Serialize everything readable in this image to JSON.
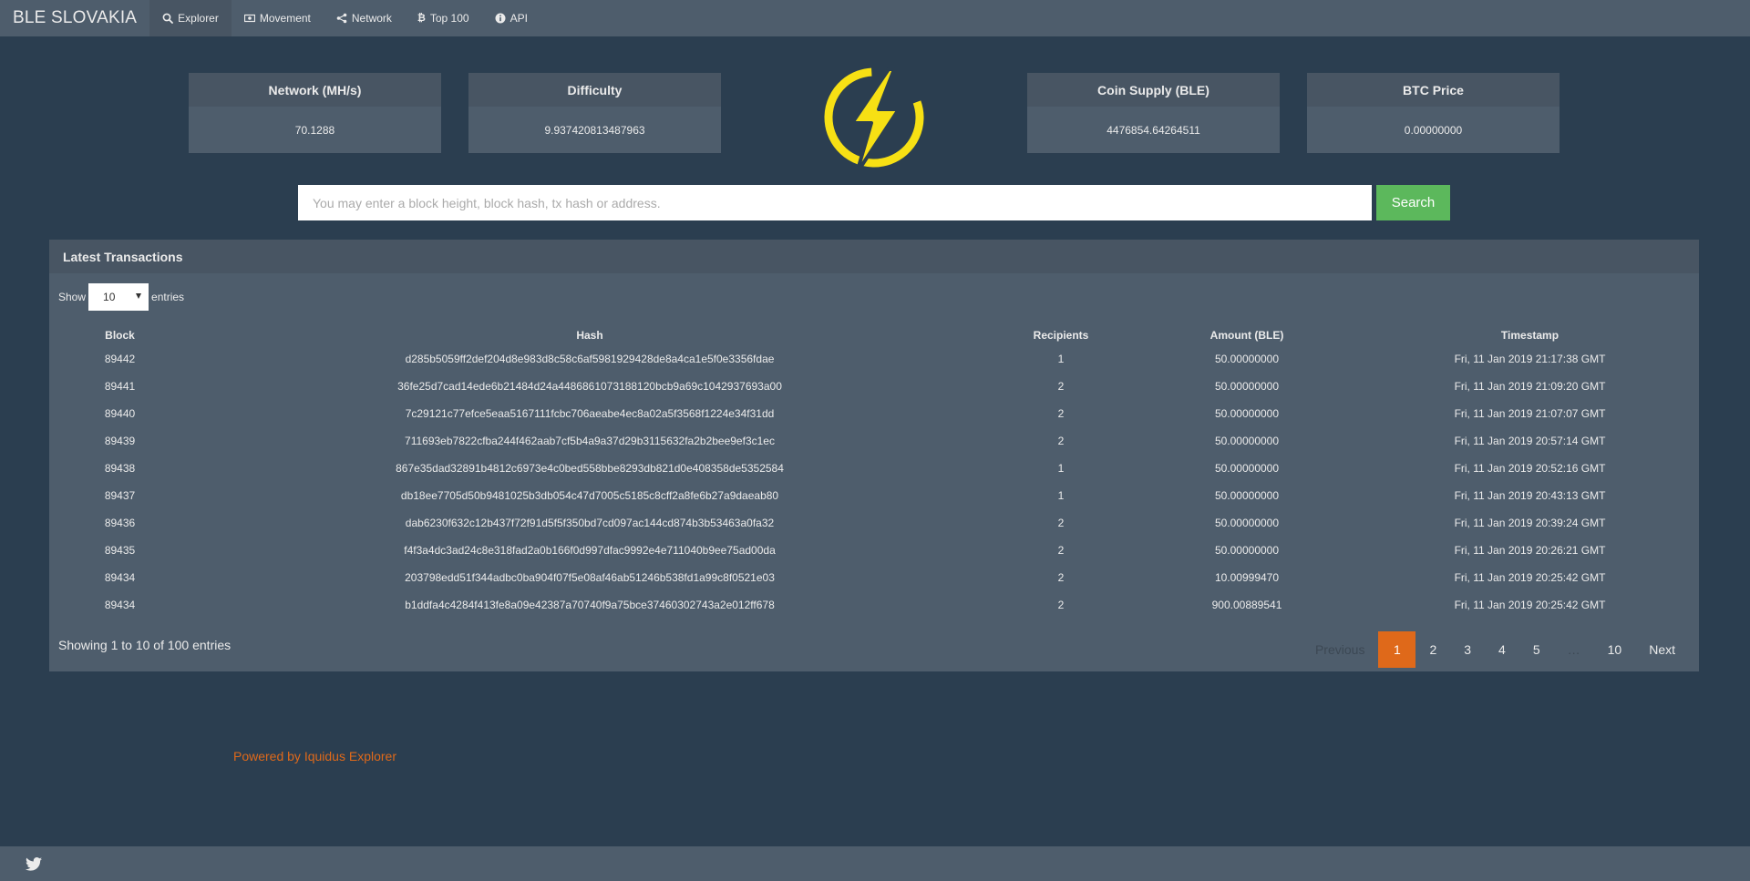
{
  "nav": {
    "brand": "BLE SLOVAKIA",
    "items": [
      {
        "label": "Explorer",
        "icon": "search-icon",
        "active": true
      },
      {
        "label": "Movement",
        "icon": "money-icon"
      },
      {
        "label": "Network",
        "icon": "share-icon"
      },
      {
        "label": "Top 100",
        "icon": "bitcoin-icon"
      },
      {
        "label": "API",
        "icon": "info-circle-icon"
      }
    ]
  },
  "stats": {
    "network": {
      "title": "Network (MH/s)",
      "value": "70.1288"
    },
    "difficulty": {
      "title": "Difficulty",
      "value": "9.937420813487963"
    },
    "supply": {
      "title": "Coin Supply (BLE)",
      "value": "4476854.64264511"
    },
    "price": {
      "title": "BTC Price",
      "value": "0.00000000"
    }
  },
  "logo": {
    "icon": "lightning-bolt-icon",
    "color": "#f7e014"
  },
  "search": {
    "placeholder": "You may enter a block height, block hash, tx hash or address.",
    "button": "Search"
  },
  "transactions": {
    "title": "Latest Transactions",
    "show_label": "Show",
    "entries_value": "10",
    "entries_label": "entries",
    "columns": [
      "Block",
      "Hash",
      "Recipients",
      "Amount (BLE)",
      "Timestamp"
    ],
    "rows": [
      [
        "89442",
        "d285b5059ff2def204d8e983d8c58c6af5981929428de8a4ca1e5f0e3356fdae",
        "1",
        "50.00000000",
        "Fri, 11 Jan 2019 21:17:38 GMT"
      ],
      [
        "89441",
        "36fe25d7cad14ede6b21484d24a4486861073188120bcb9a69c1042937693a00",
        "2",
        "50.00000000",
        "Fri, 11 Jan 2019 21:09:20 GMT"
      ],
      [
        "89440",
        "7c29121c77efce5eaa5167111fcbc706aeabe4ec8a02a5f3568f1224e34f31dd",
        "2",
        "50.00000000",
        "Fri, 11 Jan 2019 21:07:07 GMT"
      ],
      [
        "89439",
        "711693eb7822cfba244f462aab7cf5b4a9a37d29b3115632fa2b2bee9ef3c1ec",
        "2",
        "50.00000000",
        "Fri, 11 Jan 2019 20:57:14 GMT"
      ],
      [
        "89438",
        "867e35dad32891b4812c6973e4c0bed558bbe8293db821d0e408358de5352584",
        "1",
        "50.00000000",
        "Fri, 11 Jan 2019 20:52:16 GMT"
      ],
      [
        "89437",
        "db18ee7705d50b9481025b3db054c47d7005c5185c8cff2a8fe6b27a9daeab80",
        "1",
        "50.00000000",
        "Fri, 11 Jan 2019 20:43:13 GMT"
      ],
      [
        "89436",
        "dab6230f632c12b437f72f91d5f5f350bd7cd097ac144cd874b3b53463a0fa32",
        "2",
        "50.00000000",
        "Fri, 11 Jan 2019 20:39:24 GMT"
      ],
      [
        "89435",
        "f4f3a4dc3ad24c8e318fad2a0b166f0d997dfac9992e4e711040b9ee75ad00da",
        "2",
        "50.00000000",
        "Fri, 11 Jan 2019 20:26:21 GMT"
      ],
      [
        "89434",
        "203798edd51f344adbc0ba904f07f5e08af46ab51246b538fd1a99c8f0521e03",
        "2",
        "10.00999470",
        "Fri, 11 Jan 2019 20:25:42 GMT"
      ],
      [
        "89434",
        "b1ddfa4c4284f413fe8a09e42387a70740f9a75bce37460302743a2e012ff678",
        "2",
        "900.00889541",
        "Fri, 11 Jan 2019 20:25:42 GMT"
      ]
    ],
    "info": "Showing 1 to 10 of 100 entries",
    "pagination": {
      "previous": "Previous",
      "pages": [
        "1",
        "2",
        "3",
        "4",
        "5"
      ],
      "ellipsis": "…",
      "last": "10",
      "next": "Next",
      "current": "1"
    }
  },
  "footer": {
    "powered_by": "Powered by Iquidus Explorer",
    "social_icon": "twitter-icon"
  },
  "colors": {
    "background": "#2b3e50",
    "panel": "#4e5d6c",
    "accent": "#df691a",
    "search_button": "#5cb85c"
  }
}
